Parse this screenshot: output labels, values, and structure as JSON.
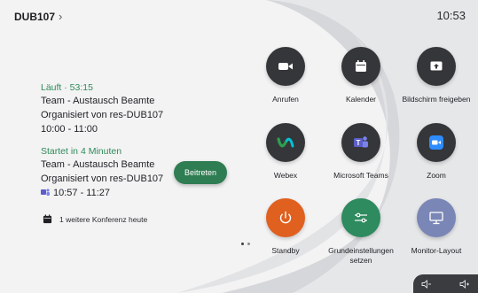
{
  "header": {
    "device_name": "DUB107",
    "chevron": "›",
    "time": "10:53"
  },
  "meetings": {
    "current": {
      "status": "Läuft · 53:15",
      "title": "Team - Austausch Beamte",
      "organizer": "Organisiert von res-DUB107",
      "time": "10:00 - 11:00"
    },
    "upcoming": {
      "status": "Startet in 4 Minuten",
      "title": "Team - Austausch Beamte",
      "organizer": "Organisiert von res-DUB107",
      "time": "10:57 - 11:27"
    },
    "join_label": "Beitreten",
    "more_today": "1 weitere Konferenz heute"
  },
  "apps": [
    {
      "label": "Anrufen",
      "icon": "video-call-icon",
      "color": "#35363a"
    },
    {
      "label": "Kalender",
      "icon": "calendar-icon",
      "color": "#35363a"
    },
    {
      "label": "Bildschirm freigeben",
      "icon": "share-screen-icon",
      "color": "#35363a"
    },
    {
      "label": "Webex",
      "icon": "webex-icon",
      "color": "#35363a"
    },
    {
      "label": "Microsoft Teams",
      "icon": "teams-icon",
      "color": "#35363a"
    },
    {
      "label": "Zoom",
      "icon": "zoom-icon",
      "color": "#35363a"
    },
    {
      "label": "Standby",
      "icon": "power-icon",
      "color": "#e0601f"
    },
    {
      "label": "Grundeinstellungen setzen",
      "icon": "sliders-icon",
      "color": "#2e8a5f"
    },
    {
      "label": "Monitor-Layout",
      "icon": "monitor-icon",
      "color": "#7a86b6"
    }
  ],
  "pagination": {
    "pages": 2,
    "active": 1
  }
}
